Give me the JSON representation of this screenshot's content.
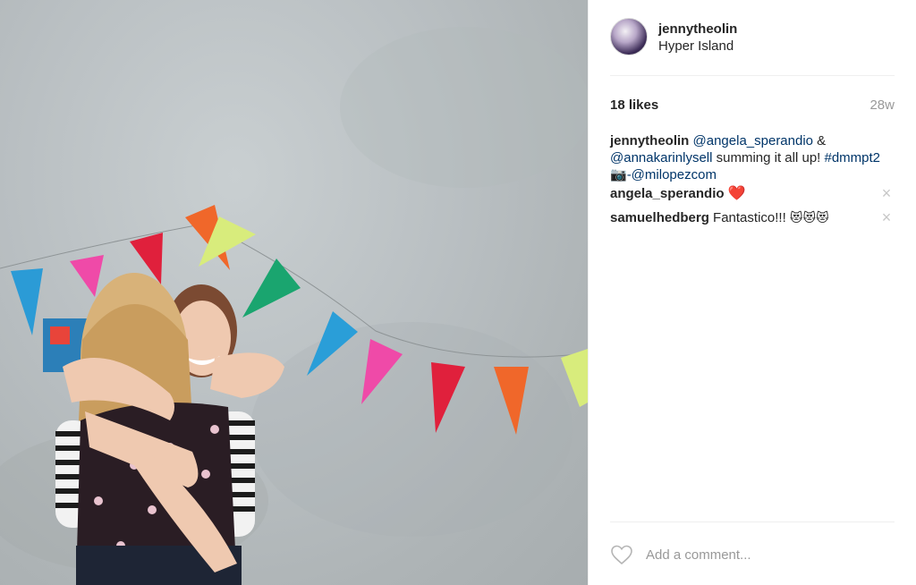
{
  "post": {
    "photo": {
      "description_icon": "photo"
    },
    "author": {
      "username": "jennytheolin",
      "location": "Hyper Island"
    },
    "likes_text": "18 likes",
    "age": "28w",
    "caption": {
      "user": "jennytheolin",
      "mention1": "@angela_sperandio",
      "amp": " & ",
      "mention2": "@annakarinlysell",
      "text": " summing it all up! ",
      "hashtag": "#dmmpt2",
      "camera": " 📷",
      "credit": "-@milopezcom"
    },
    "comments": [
      {
        "user": "angela_sperandio",
        "text": "❤️"
      },
      {
        "user": "samuelhedberg",
        "text": "Fantastico!!! ",
        "emoji": "😻😻😻"
      }
    ],
    "comment_input": {
      "placeholder": "Add a comment..."
    }
  },
  "colors": {
    "link": "#003569",
    "text": "#262626",
    "muted": "#999999",
    "divider": "#efefef"
  }
}
